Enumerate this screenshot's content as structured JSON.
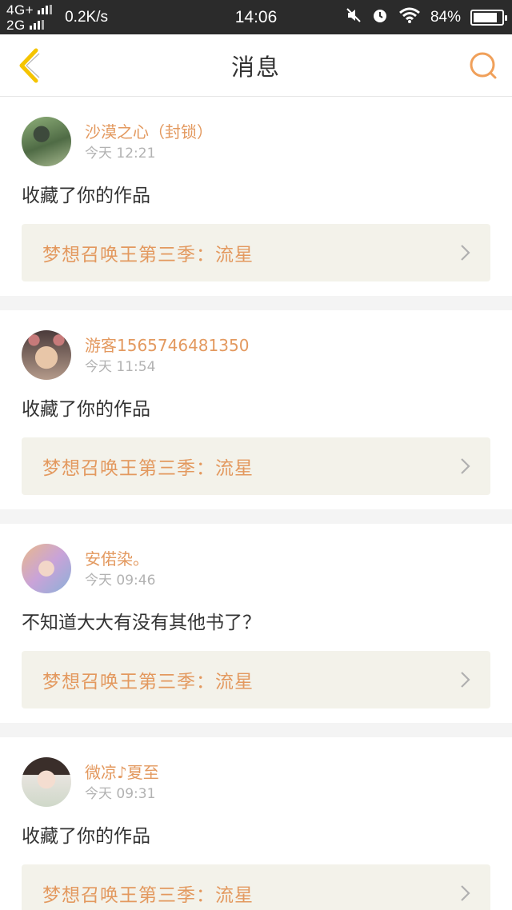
{
  "status_bar": {
    "network_top": "4G+",
    "network_bottom": "2G",
    "speed": "0.2K/s",
    "time": "14:06",
    "battery": "84%",
    "battery_level": 0.84
  },
  "header": {
    "title": "消息"
  },
  "colors": {
    "accent": "#e3995f",
    "back_icon": "#f5c400",
    "link_bg": "#f3f2ea",
    "page_bg": "#f4f4f4"
  },
  "messages": [
    {
      "username": "沙漠之心（封锁）",
      "time": "今天 12:21",
      "text": "收藏了你的作品",
      "work_title": "梦想召唤王第三季：流星"
    },
    {
      "username": "游客1565746481350",
      "time": "今天 11:54",
      "text": "收藏了你的作品",
      "work_title": "梦想召唤王第三季：流星"
    },
    {
      "username": "安偌染。",
      "time": "今天 09:46",
      "text": "不知道大大有没有其他书了？",
      "work_title": "梦想召唤王第三季：流星"
    },
    {
      "username": "微凉♪夏至",
      "time": "今天 09:31",
      "text": "收藏了你的作品",
      "work_title": "梦想召唤王第三季：流星"
    }
  ]
}
